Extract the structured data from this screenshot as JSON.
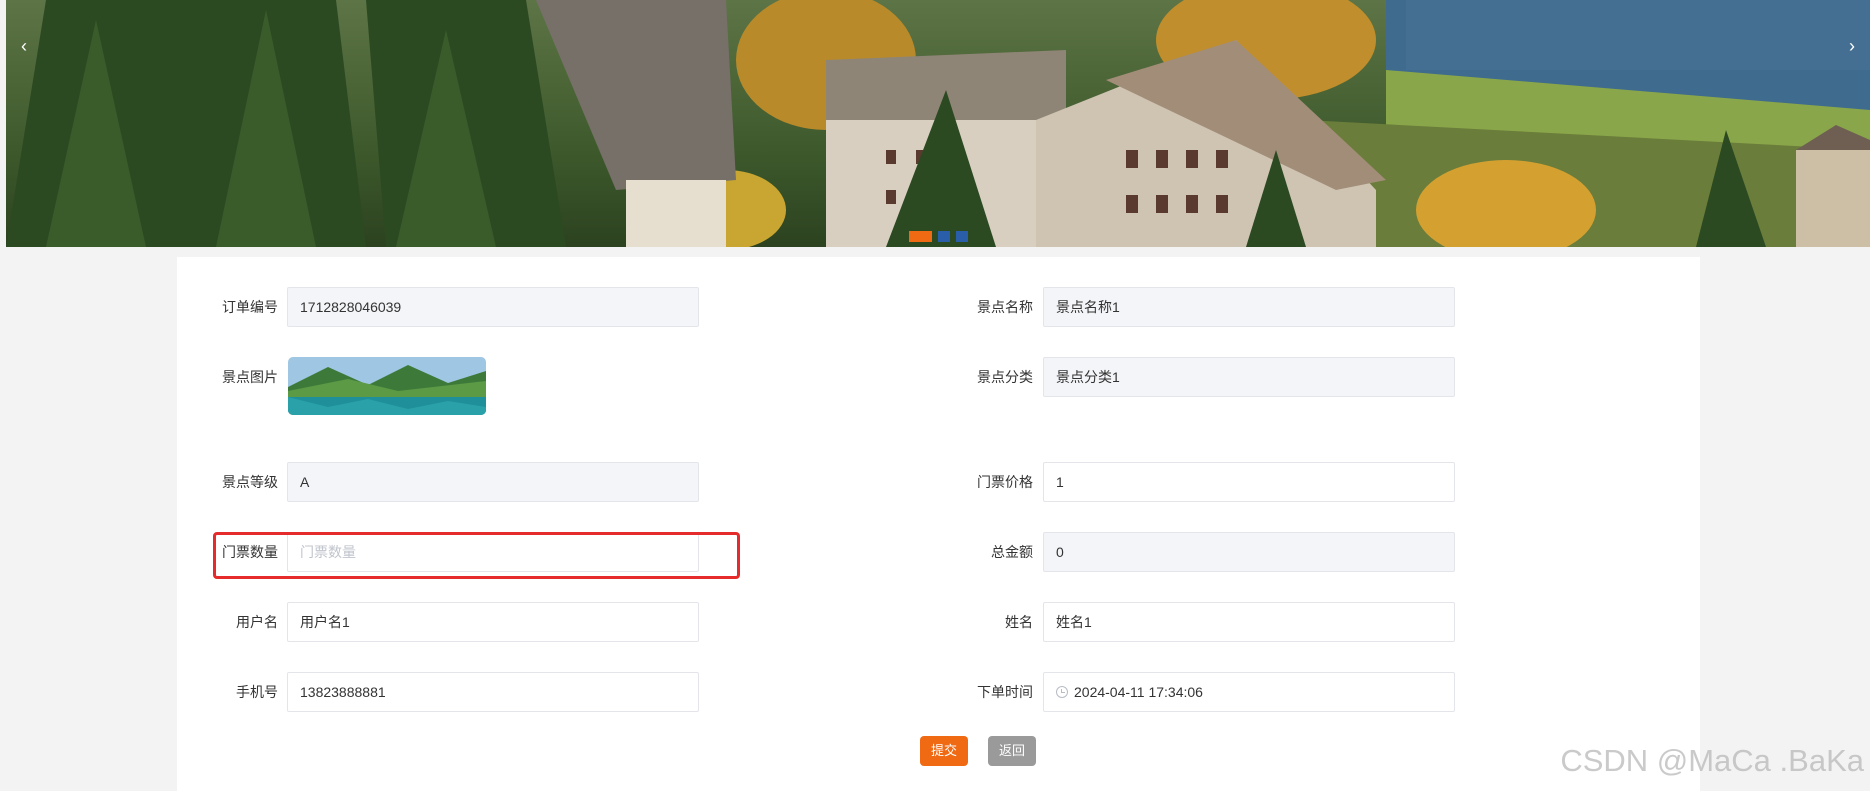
{
  "carousel": {
    "prev_icon": "‹",
    "next_icon": "›",
    "slide_count": 3,
    "active_slide": 1
  },
  "form": {
    "order_no": {
      "label": "订单编号",
      "value": "1712828046039"
    },
    "spot_name": {
      "label": "景点名称",
      "value": "景点名称1"
    },
    "spot_image": {
      "label": "景点图片"
    },
    "spot_category": {
      "label": "景点分类",
      "value": "景点分类1"
    },
    "spot_level": {
      "label": "景点等级",
      "value": "A"
    },
    "ticket_price": {
      "label": "门票价格",
      "value": "1"
    },
    "ticket_qty": {
      "label": "门票数量",
      "placeholder": "门票数量"
    },
    "total_amount": {
      "label": "总金额",
      "value": "0"
    },
    "username": {
      "label": "用户名",
      "value": "用户名1"
    },
    "full_name": {
      "label": "姓名",
      "value": "姓名1"
    },
    "phone": {
      "label": "手机号",
      "value": "13823888881"
    },
    "order_time": {
      "label": "下单时间",
      "value": "2024-04-11 17:34:06"
    }
  },
  "buttons": {
    "submit": "提交",
    "back": "返回"
  },
  "watermark": "CSDN @MaCa .BaKa",
  "colors": {
    "accent": "#f06a14",
    "highlight": "#e52b2b",
    "indicator": "#2b5ea8"
  }
}
